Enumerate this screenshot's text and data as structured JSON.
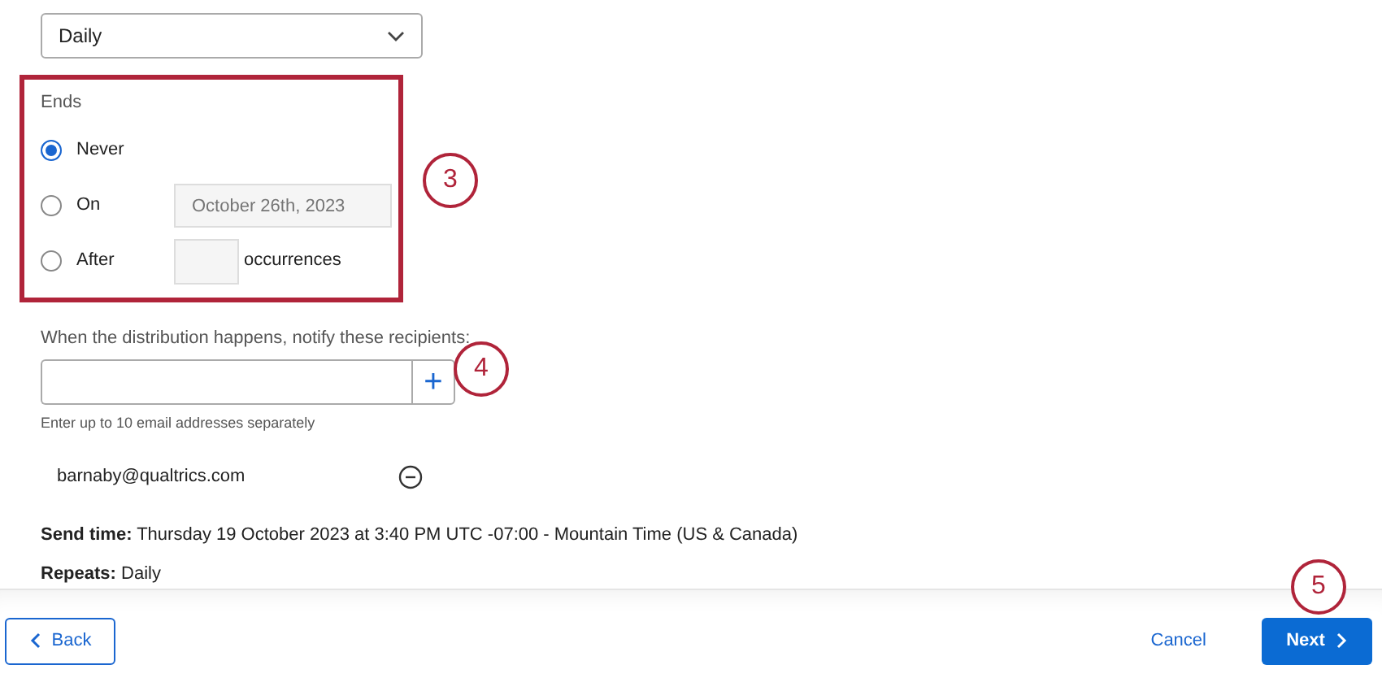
{
  "repeats_select": {
    "value": "Daily"
  },
  "ends": {
    "label": "Ends",
    "callout": "3",
    "options": [
      {
        "label": "Never",
        "selected": true,
        "kind": "plain"
      },
      {
        "label": "On",
        "selected": false,
        "kind": "date",
        "placeholder": "October 26th, 2023"
      },
      {
        "label": "After",
        "selected": false,
        "kind": "count",
        "suffix": "occurrences"
      }
    ]
  },
  "notify": {
    "label": "When the distribution happens, notify these recipients:",
    "add_button": "+",
    "callout": "4",
    "hint": "Enter up to 10 email addresses separately",
    "recipients": [
      "barnaby@qualtrics.com"
    ]
  },
  "summary": [
    {
      "label": "Send time:",
      "value": "Thursday 19 October 2023 at 3:40 PM UTC -07:00 - Mountain Time (US & Canada)"
    },
    {
      "label": "Repeats:",
      "value": "Daily"
    }
  ],
  "footer": {
    "back": "Back",
    "cancel": "Cancel",
    "next": "Next",
    "callout": "5"
  }
}
